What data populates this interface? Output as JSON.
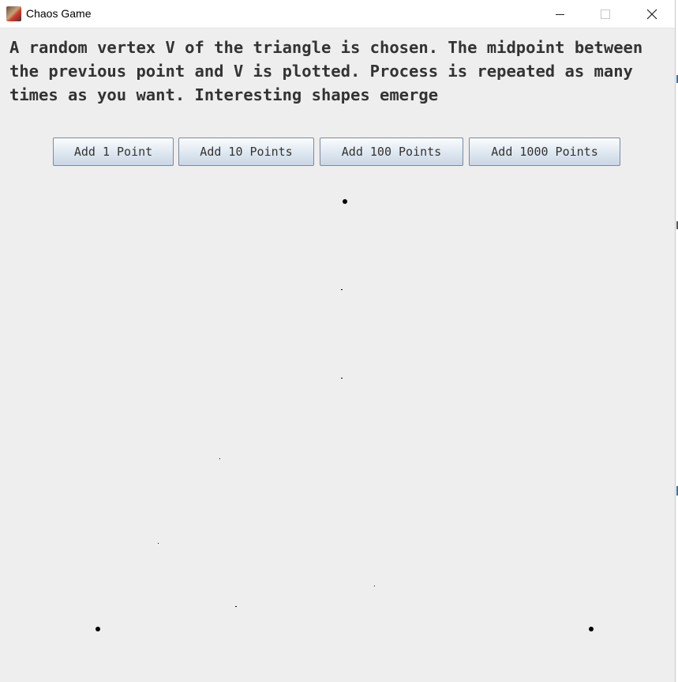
{
  "window": {
    "title": "Chaos Game"
  },
  "description": "A random vertex V of the triangle is chosen. The midpoint between the previous point and V is plotted. Process is repeated as many times as you want. Interesting shapes emerge",
  "buttons": {
    "add_1": "Add 1 Point",
    "add_10": "Add 10 Points",
    "add_100": "Add 100 Points",
    "add_1000": "Add 1000 Points"
  },
  "colors": {
    "point": "#000000",
    "background": "#eeeeee"
  }
}
